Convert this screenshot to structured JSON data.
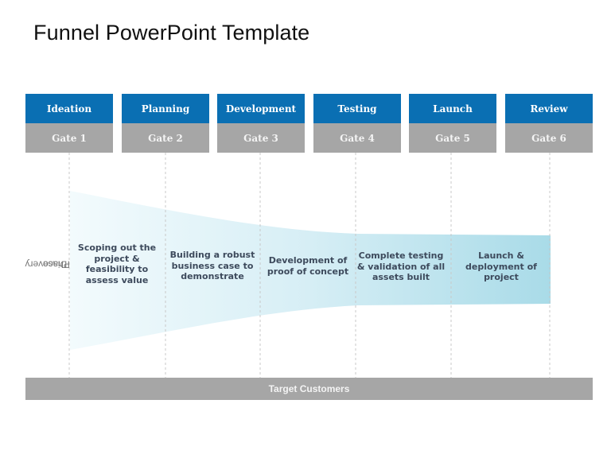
{
  "title": "Funnel PowerPoint Template",
  "stages": [
    {
      "name": "Ideation",
      "gate": "Gate 1"
    },
    {
      "name": "Planning",
      "gate": "Gate 2"
    },
    {
      "name": "Development",
      "gate": "Gate 3"
    },
    {
      "name": "Testing",
      "gate": "Gate 4"
    },
    {
      "name": "Launch",
      "gate": "Gate 5"
    },
    {
      "name": "Review",
      "gate": "Gate 6"
    }
  ],
  "phase_label": {
    "line1": "Discovery",
    "line2": "Phase"
  },
  "steps": [
    "Scoping out the project & feasibility to assess value",
    "Building a robust business case to demonstrate",
    "Development of proof of concept",
    "Complete testing & validation of all assets built",
    "Launch & deployment of project"
  ],
  "footer_bar": "Target Customers",
  "colors": {
    "stage_header": "#0a6fb3",
    "gate_row": "#a6a6a6",
    "funnel_start": "#f3fbfd",
    "funnel_end": "#a9dbe8",
    "step_text": "#3d4a5c"
  }
}
